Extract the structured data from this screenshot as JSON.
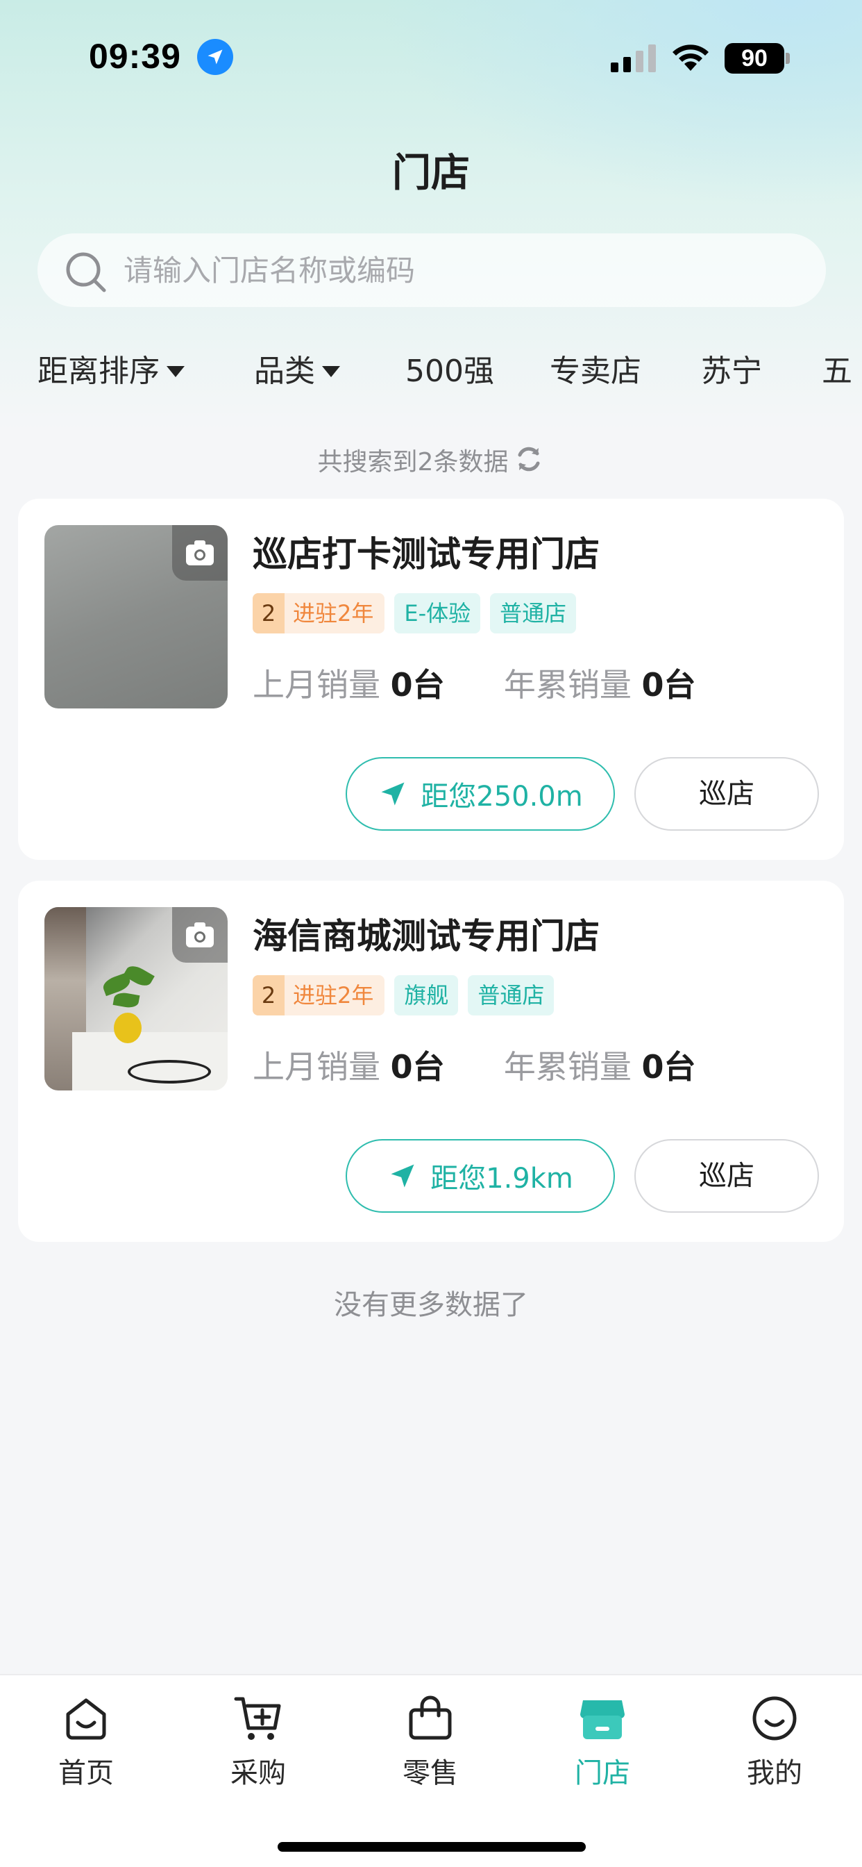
{
  "status_bar": {
    "time": "09:39",
    "battery": "90"
  },
  "page_title": "门店",
  "search": {
    "placeholder": "请输入门店名称或编码"
  },
  "filters": [
    {
      "label": "距离排序",
      "dropdown": true
    },
    {
      "label": "品类",
      "dropdown": true
    },
    {
      "label": "500强",
      "dropdown": false
    },
    {
      "label": "专卖店",
      "dropdown": false
    },
    {
      "label": "苏宁",
      "dropdown": false
    },
    {
      "label": "五",
      "dropdown": false
    }
  ],
  "result_count": "共搜索到2条数据",
  "stores": [
    {
      "name": "巡店打卡测试专用门店",
      "years_num": "2",
      "years_label": "进驻2年",
      "tags": [
        "E-体验",
        "普通店"
      ],
      "last_month_label": "上月销量",
      "last_month_value": "0台",
      "yearly_label": "年累销量",
      "yearly_value": "0台",
      "distance": "距您250.0m",
      "patrol_button": "巡店"
    },
    {
      "name": "海信商城测试专用门店",
      "years_num": "2",
      "years_label": "进驻2年",
      "tags": [
        "旗舰",
        "普通店"
      ],
      "last_month_label": "上月销量",
      "last_month_value": "0台",
      "yearly_label": "年累销量",
      "yearly_value": "0台",
      "distance": "距您1.9km",
      "patrol_button": "巡店"
    }
  ],
  "no_more": "没有更多数据了",
  "tab_bar": [
    {
      "label": "首页",
      "icon": "home-icon",
      "active": false
    },
    {
      "label": "采购",
      "icon": "cart-icon",
      "active": false
    },
    {
      "label": "零售",
      "icon": "bag-icon",
      "active": false
    },
    {
      "label": "门店",
      "icon": "store-icon",
      "active": true
    },
    {
      "label": "我的",
      "icon": "profile-icon",
      "active": false
    }
  ],
  "colors": {
    "accent": "#1fb2a4",
    "orange": "#f0873d"
  }
}
